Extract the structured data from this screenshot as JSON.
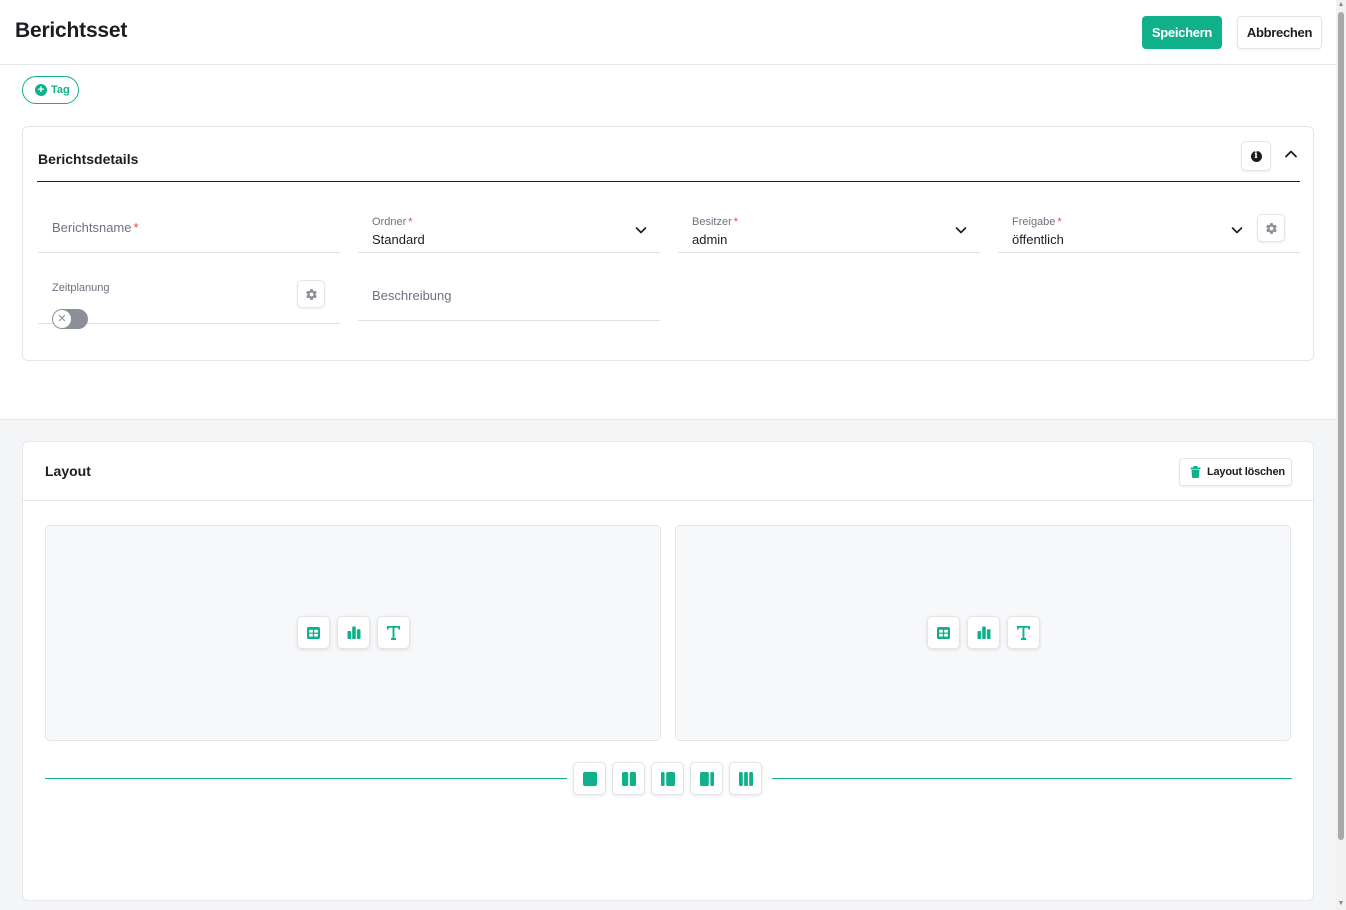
{
  "header": {
    "title": "Berichtsset",
    "save_label": "Speichern",
    "cancel_label": "Abbrechen"
  },
  "tag_button": {
    "label": "Tag"
  },
  "details": {
    "title": "Berichtsdetails",
    "fields": {
      "name": {
        "placeholder": "Berichtsname",
        "required": "*"
      },
      "folder": {
        "label": "Ordner",
        "required": "*",
        "value": "Standard"
      },
      "owner": {
        "label": "Besitzer",
        "required": "*",
        "value": "admin"
      },
      "share": {
        "label": "Freigabe",
        "required": "*",
        "value": "öffentlich"
      },
      "schedule": {
        "label": "Zeitplanung",
        "enabled": false
      },
      "description": {
        "placeholder": "Beschreibung"
      }
    }
  },
  "layout": {
    "title": "Layout",
    "clear_label": "Layout löschen",
    "slots": [
      {
        "tools": [
          "table-icon",
          "bar-chart-icon",
          "text-icon"
        ]
      },
      {
        "tools": [
          "table-icon",
          "bar-chart-icon",
          "text-icon"
        ]
      }
    ],
    "column_options": [
      "one-column-icon",
      "two-column-icon",
      "left-narrow-icon",
      "right-narrow-icon",
      "three-column-icon"
    ]
  },
  "colors": {
    "accent": "#10b08a",
    "required": "#e5484d"
  }
}
